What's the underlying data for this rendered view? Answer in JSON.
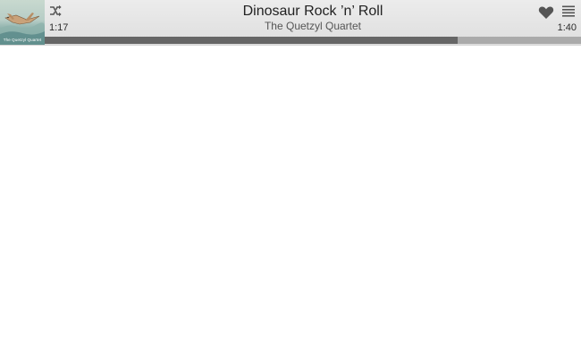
{
  "now_playing": {
    "title": "Dinosaur Rock ’n’ Roll",
    "artist": "The Quetzyl Quartet",
    "album_caption": "The Quetzyl Quartet",
    "elapsed": "1:17",
    "duration": "1:40",
    "progress_fraction": 0.77
  },
  "icons": {
    "shuffle": "shuffle-icon",
    "favorite": "heart-icon",
    "queue": "list-icon"
  },
  "colors": {
    "bar_background": "#e5e5e5",
    "progress_fill": "#666666",
    "progress_track": "#aaaaaa",
    "icon": "#555555"
  }
}
